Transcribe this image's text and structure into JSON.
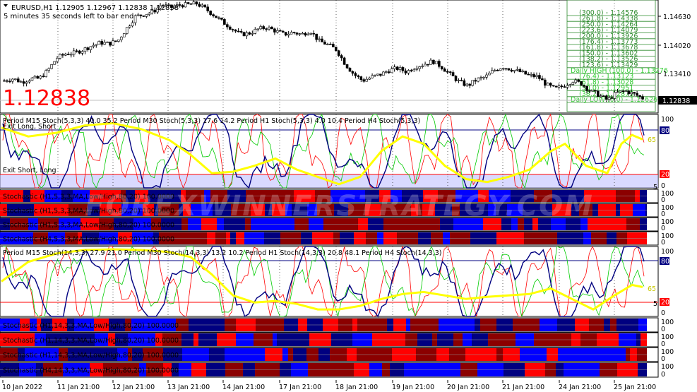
{
  "header": {
    "symbol_line": "EURUSD,H1  1.12905 1.12967 1.12838 1.12838",
    "timer": "5 minutes 35 seconds left to bar end"
  },
  "current_price": "1.12838",
  "price_box": "1.12838",
  "price_axis": [
    "1.14630",
    "1.14020",
    "1.13410"
  ],
  "fib_levels": [
    {
      "label": "(300.0) - 1.14576",
      "row": 0
    },
    {
      "label": "(261.8) - 1.14338",
      "row": 1
    },
    {
      "label": "(250.0) - 1.14264",
      "row": 2
    },
    {
      "label": "(223.6) - 1.14079",
      "row": 3
    },
    {
      "label": "(200.0) - 1.13926",
      "row": 4
    },
    {
      "label": "(176.4) - 1.13773",
      "row": 5
    },
    {
      "label": "(161.8) - 1.13678",
      "row": 6
    },
    {
      "label": "(150.0) - 1.13602",
      "row": 7
    },
    {
      "label": "(138.2) - 1.13526",
      "row": 8
    },
    {
      "label": "(123.6) - 1.13429",
      "row": 9
    },
    {
      "label": "Daily HIGH (100.0) - 1.13276",
      "row": 10
    },
    {
      "label": "(76.4) - 1.13123",
      "row": 11
    },
    {
      "label": "(61.8) - 1.13028",
      "row": 12
    },
    {
      "label": "(50.0) - 1.12951",
      "row": 13
    },
    {
      "label": "(38.2) - 1.12875",
      "row": 14
    },
    {
      "label": "Daily LOW (0.0) - 1.12626",
      "row": 15
    }
  ],
  "panel1": {
    "title": "Period M15 Stoch(5,3,3) 40.0 35.2  Period M30 Stoch(5,3,3) 17.6 14.2  Period H1 Stoch(5,3,3) 4.0 10.4  Period H4 Stoch(5,3,3)",
    "exit_long": "Exit Long, Short",
    "exit_short": "Exit Short, Long",
    "levels": {
      "l100": "100",
      "l80": "80",
      "l65": "65",
      "l20": "20",
      "l5": "5",
      "l0": "0"
    }
  },
  "panel2": {
    "title": "Period M15 Stoch(14,3,3) 27.9 21.0  Period M30 Stoch(14,3,3) 13.2 10.2  Period H1 Stoch(14,3,3) 20.8 48.1  Period H4 Stoch(14,3,3)",
    "levels": {
      "l100": "100",
      "l80": "80",
      "l65": "65",
      "l20": "20",
      "l5": "5",
      "l0": "0"
    }
  },
  "bar_panels": [
    {
      "label": "Stochastic (H1,5,3,3,MA,Low/High,80,20)  100.0000",
      "top": "100",
      "bottom": "0"
    },
    {
      "label": "Stochastic (H1,5,3,3,MA,Low/High,80,20)  100.0000",
      "top": "100",
      "bottom": "0"
    },
    {
      "label": "Stochastic (H1,5,3,3,MA,Low/High,80,20)  100.0000",
      "top": "100",
      "bottom": "0"
    },
    {
      "label": "Stochastic (H4,5,3,3,MA,Low/High,80,20)  100.0000",
      "top": "100",
      "bottom": "0"
    },
    {
      "label": "Stochastic (H1,14,3,3,MA,Low/High,80,20)  100.0000",
      "top": "100",
      "bottom": "0"
    },
    {
      "label": "Stochastic (H1,14,3,3,MA,Low/High,80,20)  100.0000",
      "top": "100",
      "bottom": "0"
    },
    {
      "label": "Stochastic (H1,14,3,3,MA,Low/High,80,20)  100.0000",
      "top": "100",
      "bottom": "0"
    },
    {
      "label": "Stochastic (H4,14,3,3,MA,Low/High,80,20)  100.0000",
      "top": "100",
      "bottom": "0"
    }
  ],
  "watermark": "FOREXWINNERSTRATEGY.COM",
  "colors": {
    "bull_bar": "#ff0000",
    "bear_bar": "#0000ff",
    "dark_red": "#8b0000",
    "dark_blue": "#000080",
    "yellow": "#ffff00",
    "green": "#00cc00",
    "red_line": "#ff0000",
    "navy": "#000080"
  },
  "chart_data": {
    "type": "line",
    "symbol": "EURUSD",
    "timeframe": "H1",
    "x": [
      "10 Jan 2022",
      "11 Jan 21:00",
      "12 Jan 21:00",
      "13 Jan 21:00",
      "14 Jan 21:00",
      "17 Jan 21:00",
      "18 Jan 21:00",
      "19 Jan 21:00",
      "20 Jan 21:00",
      "21 Jan 21:00",
      "24 Jan 21:00",
      "25 Jan 21:00"
    ],
    "ylim": [
      1.1255,
      1.1475
    ],
    "y_ticks": [
      1.1341,
      1.1402,
      1.1463
    ],
    "ohlc_last": {
      "open": 1.12905,
      "high": 1.12967,
      "low": 1.12838,
      "close": 1.12838
    },
    "price_path": [
      1.1318,
      1.1322,
      1.1315,
      1.1322,
      1.1322,
      1.1338,
      1.1362,
      1.137,
      1.1372,
      1.1378,
      1.1386,
      1.1392,
      1.139,
      1.1396,
      1.142,
      1.1443,
      1.1447,
      1.1452,
      1.1466,
      1.146,
      1.1465,
      1.1466,
      1.1468,
      1.1458,
      1.1445,
      1.1432,
      1.142,
      1.1408,
      1.141,
      1.1418,
      1.1422,
      1.1415,
      1.1408,
      1.1412,
      1.1408,
      1.1415,
      1.1395,
      1.1388,
      1.1378,
      1.135,
      1.133,
      1.1318,
      1.1325,
      1.133,
      1.1338,
      1.1342,
      1.1335,
      1.1345,
      1.135,
      1.1356,
      1.1345,
      1.133,
      1.1316,
      1.1308,
      1.132,
      1.1325,
      1.1338,
      1.1345,
      1.134,
      1.1335,
      1.1328,
      1.1326,
      1.131,
      1.1302,
      1.1308,
      1.1318,
      1.1312,
      1.1298,
      1.129,
      1.128,
      1.1294,
      1.1298,
      1.1292,
      1.1284
    ],
    "stoch_panel1_levels": [
      100,
      80,
      20,
      0
    ],
    "stoch_panel2_levels": [
      100,
      80,
      20,
      0
    ]
  }
}
